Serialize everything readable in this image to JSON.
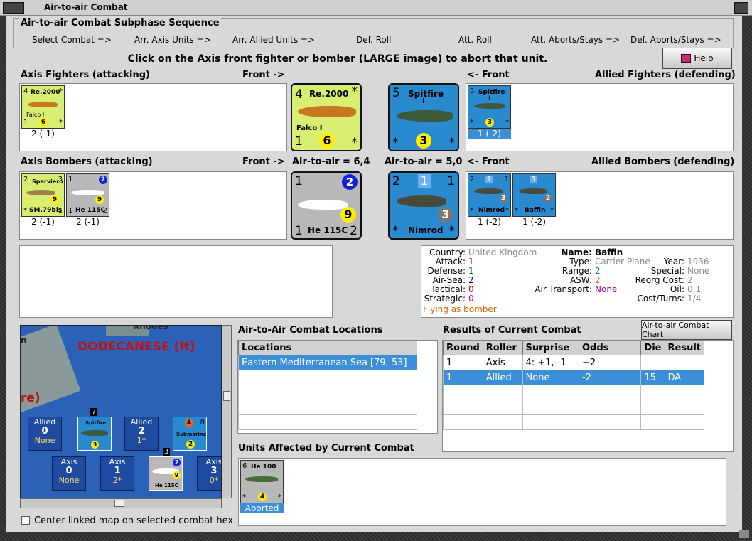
{
  "window": {
    "title": "Air-to-air Combat"
  },
  "subphase": {
    "title": "Air-to-air Combat Subphase Sequence",
    "steps": [
      "Select Combat =>",
      "Arr. Axis Units =>",
      "Arr. Allied Units =>",
      "Def. Roll",
      "Att. Roll",
      "Att. Aborts/Stays =>",
      "Def. Aborts/Stays =>"
    ]
  },
  "instruction": "Click on the Axis front fighter or bomber  (LARGE image) to abort that unit.",
  "help_label": "Help",
  "headers": {
    "axis_fighters": "Axis Fighters (attacking)",
    "front_right": "Front ->",
    "front_left": "<- Front",
    "allied_fighters": "Allied Fighters (defending)",
    "axis_bombers": "Axis Bombers (attacking)",
    "air_to_air_axis": "Air-to-air = 6,4",
    "air_to_air_allied": "Air-to-air = 5,0",
    "allied_bombers": "Allied Bombers (defending)"
  },
  "axis_fighters": [
    {
      "name": "Re.2000",
      "sub": "Falco I",
      "tl": "4",
      "tr": "*",
      "bl": "1",
      "br": "*",
      "circle": "6",
      "caption": "2 (-1)"
    }
  ],
  "allied_fighters": [
    {
      "name": "Spitfire",
      "sub": "I",
      "tl": "5",
      "tr": "",
      "bl": "*",
      "br": "*",
      "circle": "3",
      "caption": "1 (-2)"
    }
  ],
  "axis_bombers": [
    {
      "name": "Sparviero",
      "sub": "SM.79bis",
      "tl": "2",
      "tr": "3",
      "bl": "*",
      "br": "1",
      "circle": "9",
      "caption": "2 (-1)"
    },
    {
      "name": "He 115C",
      "sub": "",
      "tl": "1",
      "tr": "2",
      "bl": "1",
      "br": "2",
      "circle": "9",
      "caption": "2 (-1)"
    }
  ],
  "allied_bombers": [
    {
      "name": "Nimrod",
      "sub": "",
      "tl": "2",
      "tr": "1",
      "mid": "1",
      "bl": "*",
      "br": "*",
      "circle": "3",
      "caption": "1 (-2)"
    },
    {
      "name": "Baffin",
      "sub": "",
      "tl": "",
      "tr": "",
      "mid": "1",
      "bl": "*",
      "br": "*",
      "circle": "2",
      "caption": "1 (-2)"
    }
  ],
  "front": {
    "axis_fighter": {
      "name": "Re.2000",
      "sub": "Falco I",
      "tl": "4",
      "tr": "*",
      "bl": "1",
      "br": "*",
      "circle": "6"
    },
    "allied_fighter": {
      "name": "Spitfire",
      "sub": "I",
      "tl": "5",
      "tr": "",
      "bl": "*",
      "br": "*",
      "circle": "3"
    },
    "axis_bomber": {
      "name": "He 115C",
      "tl": "1",
      "tr": "2",
      "bl": "1",
      "br": "2",
      "circle": "9"
    },
    "allied_bomber": {
      "name": "Nimrod",
      "tl": "2",
      "mid": "1",
      "tr": "1",
      "bl": "*",
      "br": "*",
      "circle": "3"
    }
  },
  "unit_info": {
    "country_label": "Country:",
    "country": "United Kingdom",
    "attack_label": "Attack:",
    "attack": "1",
    "defense_label": "Defense:",
    "defense": "1",
    "airsea_label": "Air-Sea:",
    "airsea": "2",
    "tactical_label": "Tactical:",
    "tactical": "0",
    "strategic_label": "Strategic:",
    "strategic": "0",
    "flying": "Flying as bomber",
    "name_label": "Name:",
    "name": "Baffin",
    "type_label": "Type:",
    "type": "Carrier Plane",
    "range_label": "Range:",
    "range": "2",
    "asw_label": "ASW:",
    "asw": "2",
    "transport_label": "Air Transport:",
    "transport": "None",
    "year_label": "Year:",
    "year": "1936",
    "special_label": "Special:",
    "special": "None",
    "reorg_label": "Reorg Cost:",
    "reorg": "2",
    "oil_label": "Oil:",
    "oil": "0,1",
    "cost_label": "Cost/Turns:",
    "cost": "1/4"
  },
  "colors": {
    "attack": "#cc0000",
    "defense": "#007700",
    "airsea": "#0000aa",
    "tactical": "#cc0000",
    "strategic": "#aa00aa",
    "range": "#0077aa",
    "asw": "#dd7700",
    "transport": "#8800aa",
    "flying": "#cc6600",
    "gray": "#888888"
  },
  "map": {
    "labels": {
      "rhodes": "Rhodes",
      "dodecanese": "DODECANESE (It)",
      "partial": "re)",
      "n": "n"
    },
    "units": [
      {
        "top": "Allied",
        "num": "0",
        "bot": "None"
      },
      {
        "top": "Allied",
        "num": "2",
        "bot": "1*"
      },
      {
        "top": "Axis",
        "num": "0",
        "bot": "None"
      },
      {
        "top": "Axis",
        "num": "1",
        "bot": "2*"
      },
      {
        "top": "Axis",
        "num": "3",
        "bot": "0*"
      }
    ],
    "stack_counts": [
      "7",
      "3"
    ],
    "sub_label": "Submarine",
    "sub_nums": [
      "4",
      "8",
      "2"
    ]
  },
  "center_map_label": "Center linked map on selected combat hex",
  "locations": {
    "title": "Air-to-Air Combat Locations",
    "column": "Locations",
    "rows": [
      "Eastern Mediterranean Sea [79, 53]"
    ]
  },
  "results": {
    "title": "Results of Current Combat",
    "chart_button": "Air-to-air Combat Chart",
    "columns": [
      "Round",
      "Roller",
      "Surprise",
      "Odds",
      "Die",
      "Result"
    ],
    "rows": [
      [
        "1",
        "Axis",
        "4: +1, -1",
        "+2",
        "",
        ""
      ],
      [
        "1",
        "Allied",
        "None",
        "-2",
        "15",
        "DA"
      ]
    ]
  },
  "affected": {
    "title": "Units Affected by Current Combat",
    "units": [
      {
        "name": "He 100",
        "tl": "6",
        "bl": "*",
        "br": "*",
        "circle": "4",
        "caption": "Aborted"
      }
    ]
  }
}
